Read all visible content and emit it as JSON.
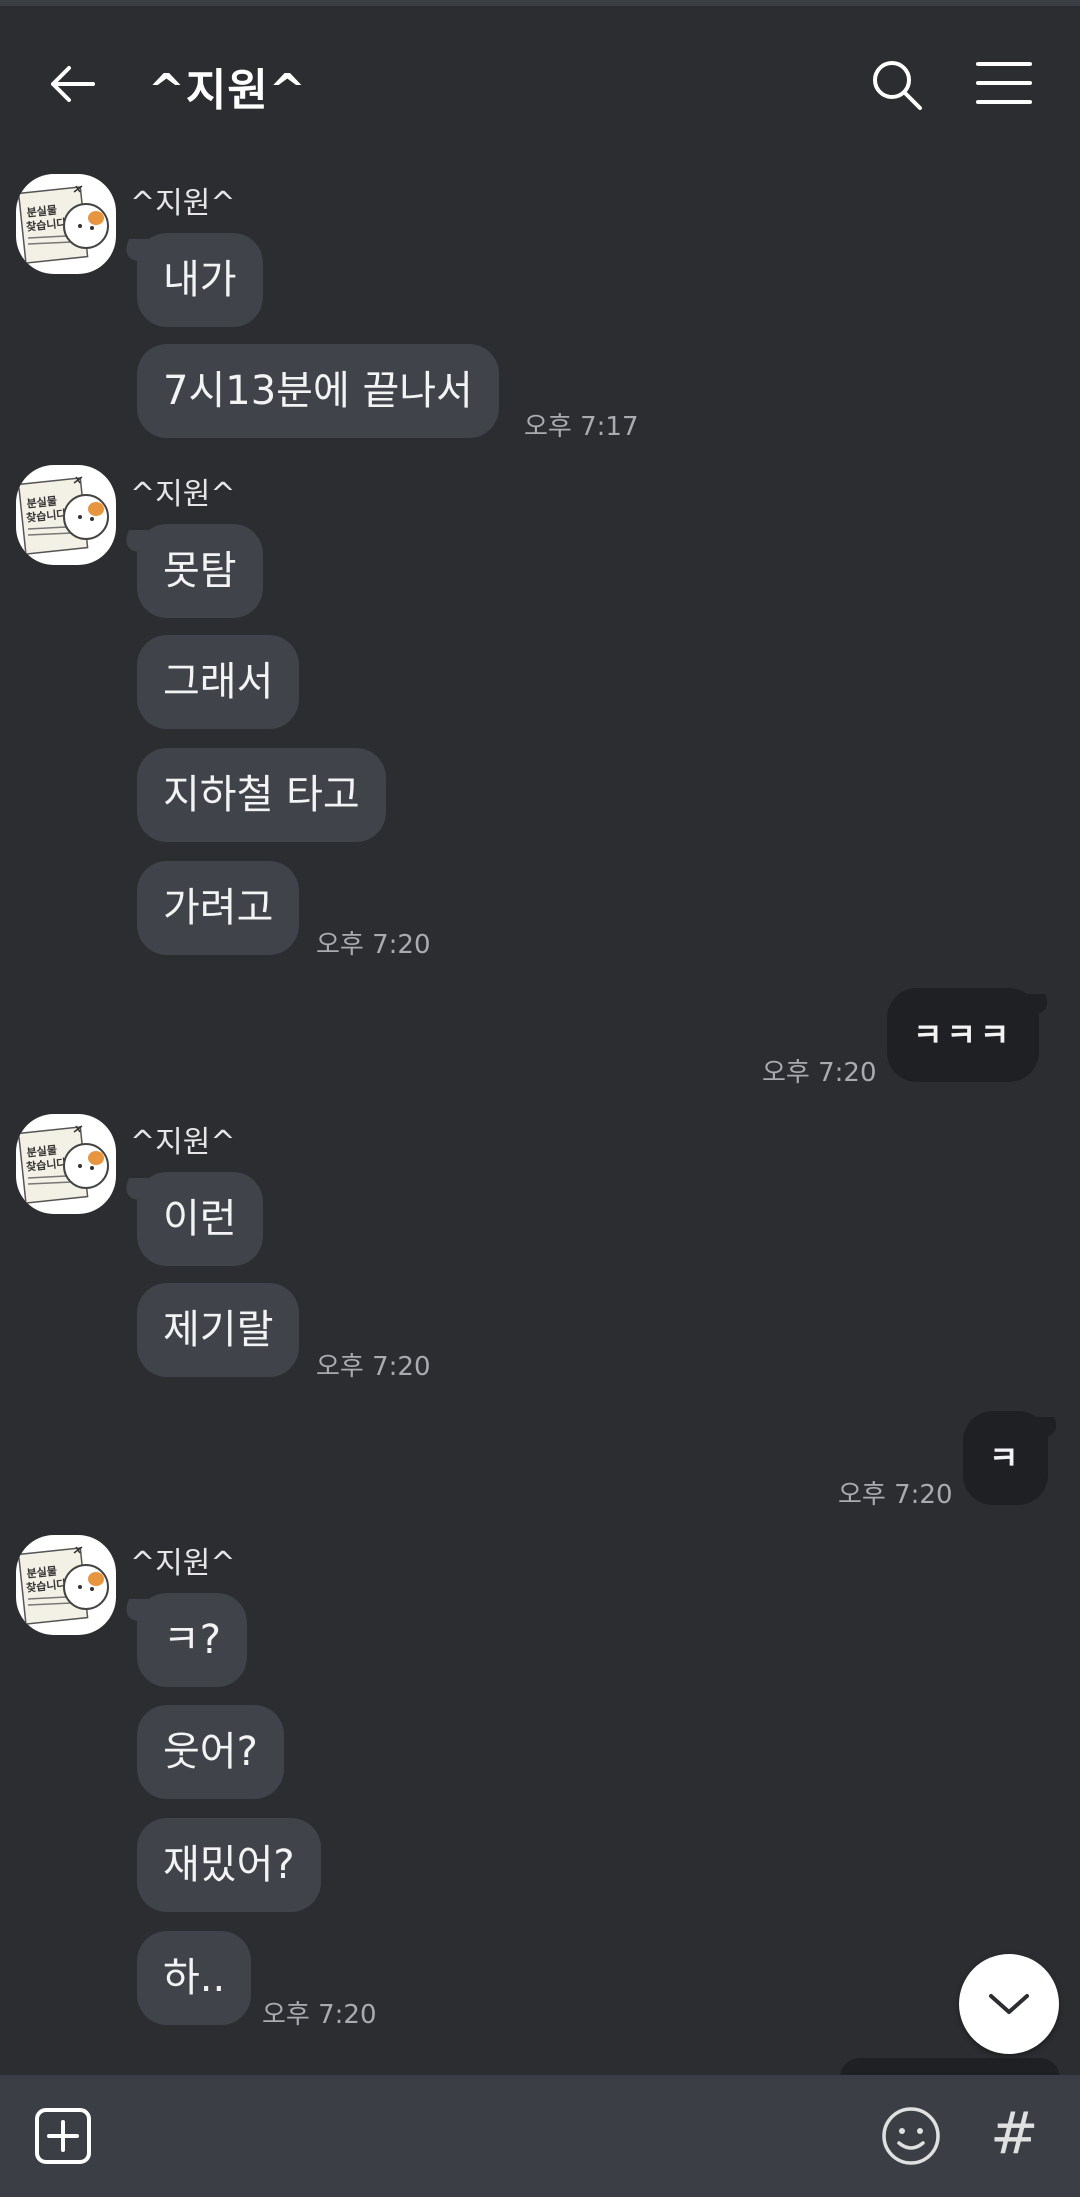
{
  "header": {
    "title": "^지원^"
  },
  "messages": [
    {
      "sender": "^지원^",
      "bubbles": [
        "내가",
        "7시13분에  끝나서"
      ],
      "time": "오후 7:17"
    },
    {
      "sender": "^지원^",
      "bubbles": [
        "못탐",
        "그래서",
        "지하철 타고",
        "가려고"
      ],
      "time": "오후 7:20"
    },
    {
      "mine": true,
      "bubbles": [
        "ㅋㅋㅋ"
      ],
      "time": "오후 7:20"
    },
    {
      "sender": "^지원^",
      "bubbles": [
        "이런",
        "제기랄"
      ],
      "time": "오후 7:20"
    },
    {
      "mine": true,
      "bubbles": [
        "ㅋ"
      ],
      "time": "오후 7:20"
    },
    {
      "sender": "^지원^",
      "bubbles": [
        "ㅋ?",
        "웃어?",
        "재밌어?",
        "하.."
      ],
      "time": "오후 7:20"
    }
  ],
  "avatar_text": {
    "line1": "분실물",
    "line2": "찾습니다"
  },
  "input": {
    "hash_label": "#"
  },
  "colors": {
    "background": "#2b2d31",
    "bubble_other": "#40434a",
    "bubble_mine": "#1f2024",
    "input_bar": "#3b3e44"
  }
}
